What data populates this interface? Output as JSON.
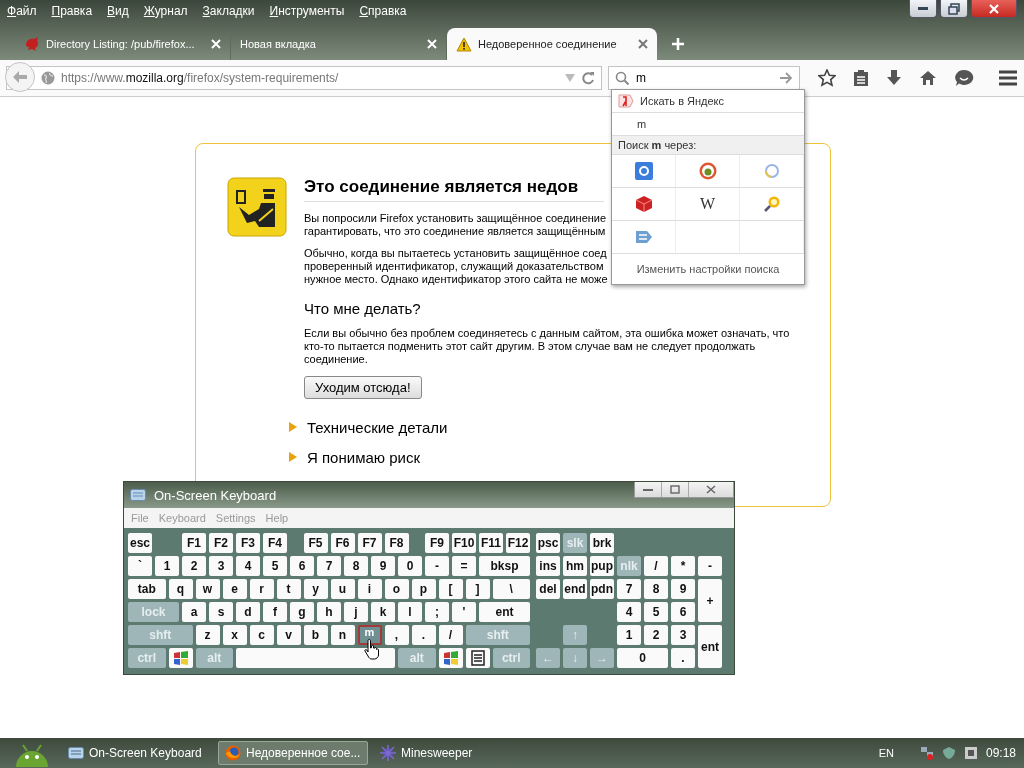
{
  "menu": [
    "Файл",
    "Правка",
    "Вид",
    "Журнал",
    "Закладки",
    "Инструменты",
    "Справка"
  ],
  "tabs": [
    {
      "title": "Directory Listing: /pub/firefox...",
      "kind": "site",
      "selected": false
    },
    {
      "title": "Новая вкладка",
      "kind": "plain",
      "selected": false
    },
    {
      "title": "Недоверенное соединение",
      "kind": "warning",
      "selected": true
    }
  ],
  "navbar": {
    "url": {
      "scheme": "https://www.",
      "domain": "mozilla.org",
      "path": "/firefox/system-requirements/"
    },
    "search": {
      "value": "m"
    }
  },
  "search_popup": {
    "header": "Искать в Яндекс",
    "query": "m",
    "via": "Поиск **m** через:",
    "engines": [
      {
        "kind": "google"
      },
      {
        "kind": "duck"
      },
      {
        "kind": "ring"
      },
      {
        "kind": "cube"
      },
      {
        "kind": "wiki",
        "label": "W"
      },
      {
        "kind": "magnifier"
      },
      {
        "kind": "arrow"
      }
    ],
    "settings": "Изменить настройки поиска"
  },
  "error": {
    "title": "Это соединение является недов",
    "paragraphs": [
      [
        "Вы попросили Firefox установить защищённое соединение",
        "гарантировать, что это соединение является защищённым"
      ],
      [
        "Обычно, когда вы пытаетесь установить защищённое соед",
        "проверенный идентификатор, служащий доказательством",
        "нужное место. Однако идентификатор этого сайта не може"
      ]
    ],
    "subtitle": "Что мне делать?",
    "advice": "Если вы обычно без проблем соединяетесь с данным сайтом, эта ошибка может означать, что кто-то пытается подменить этот сайт другим. В этом случае вам не следует продолжать соединение.",
    "button": "Уходим отсюда!",
    "sections": [
      {
        "label": "Технические детали",
        "expanded": false
      },
      {
        "label": "Я понимаю риск",
        "expanded": false
      }
    ]
  },
  "keyboard": {
    "title": "On-Screen Keyboard",
    "menu": [
      "File",
      "Keyboard",
      "Settings",
      "Help"
    ],
    "function_groups": [
      [
        {
          "label": "esc",
          "kind": "key",
          "disabled": false,
          "pressed": false
        }
      ],
      [
        {
          "label": "F1",
          "kind": "key",
          "disabled": false,
          "pressed": false
        },
        {
          "label": "F2",
          "kind": "key",
          "disabled": false,
          "pressed": false
        },
        {
          "label": "F3",
          "kind": "key",
          "disabled": false,
          "pressed": false
        },
        {
          "label": "F4",
          "kind": "key",
          "disabled": false,
          "pressed": false
        }
      ],
      [
        {
          "label": "F5",
          "kind": "key",
          "disabled": false,
          "pressed": false
        },
        {
          "label": "F6",
          "kind": "key",
          "disabled": false,
          "pressed": false
        },
        {
          "label": "F7",
          "kind": "key",
          "disabled": false,
          "pressed": false
        },
        {
          "label": "F8",
          "kind": "key",
          "disabled": false,
          "pressed": false
        }
      ],
      [
        {
          "label": "F9",
          "kind": "key",
          "disabled": false,
          "pressed": false
        },
        {
          "label": "F10",
          "kind": "key",
          "disabled": false,
          "pressed": false
        },
        {
          "label": "F11",
          "kind": "key",
          "disabled": false,
          "pressed": false
        },
        {
          "label": "F12",
          "kind": "key",
          "disabled": false,
          "pressed": false
        }
      ]
    ],
    "main_rows": [
      [
        {
          "label": "`",
          "kind": "key",
          "disabled": false,
          "pressed": false
        },
        {
          "label": "1",
          "kind": "key",
          "disabled": false,
          "pressed": false
        },
        {
          "label": "2",
          "kind": "key",
          "disabled": false,
          "pressed": false
        },
        {
          "label": "3",
          "kind": "key",
          "disabled": false,
          "pressed": false
        },
        {
          "label": "4",
          "kind": "key",
          "disabled": false,
          "pressed": false
        },
        {
          "label": "5",
          "kind": "key",
          "disabled": false,
          "pressed": false
        },
        {
          "label": "6",
          "kind": "key",
          "disabled": false,
          "pressed": false
        },
        {
          "label": "7",
          "kind": "key",
          "disabled": false,
          "pressed": false
        },
        {
          "label": "8",
          "kind": "key",
          "disabled": false,
          "pressed": false
        },
        {
          "label": "9",
          "kind": "key",
          "disabled": false,
          "pressed": false
        },
        {
          "label": "0",
          "kind": "key",
          "disabled": false,
          "pressed": false
        },
        {
          "label": "-",
          "kind": "key",
          "disabled": false,
          "pressed": false
        },
        {
          "label": "=",
          "kind": "key",
          "disabled": false,
          "pressed": false
        },
        {
          "label": "bksp",
          "kind": "wide",
          "disabled": false,
          "pressed": false
        }
      ],
      [
        {
          "label": "tab",
          "kind": "medium",
          "disabled": false,
          "pressed": false
        },
        {
          "label": "q",
          "kind": "key",
          "disabled": false,
          "pressed": false
        },
        {
          "label": "w",
          "kind": "key",
          "disabled": false,
          "pressed": false
        },
        {
          "label": "e",
          "kind": "key",
          "disabled": false,
          "pressed": false
        },
        {
          "label": "r",
          "kind": "key",
          "disabled": false,
          "pressed": false
        },
        {
          "label": "t",
          "kind": "key",
          "disabled": false,
          "pressed": false
        },
        {
          "label": "y",
          "kind": "key",
          "disabled": false,
          "pressed": false
        },
        {
          "label": "u",
          "kind": "key",
          "disabled": false,
          "pressed": false
        },
        {
          "label": "i",
          "kind": "key",
          "disabled": false,
          "pressed": false
        },
        {
          "label": "o",
          "kind": "key",
          "disabled": false,
          "pressed": false
        },
        {
          "label": "p",
          "kind": "key",
          "disabled": false,
          "pressed": false
        },
        {
          "label": "[",
          "kind": "key",
          "disabled": false,
          "pressed": false
        },
        {
          "label": "]",
          "kind": "key",
          "disabled": false,
          "pressed": false
        },
        {
          "label": "\\",
          "kind": "medium",
          "disabled": false,
          "pressed": false
        }
      ],
      [
        {
          "label": "lock",
          "kind": "wide",
          "disabled": true,
          "pressed": false
        },
        {
          "label": "a",
          "kind": "key",
          "disabled": false,
          "pressed": false
        },
        {
          "label": "s",
          "kind": "key",
          "disabled": false,
          "pressed": false
        },
        {
          "label": "d",
          "kind": "key",
          "disabled": false,
          "pressed": false
        },
        {
          "label": "f",
          "kind": "key",
          "disabled": false,
          "pressed": false
        },
        {
          "label": "g",
          "kind": "key",
          "disabled": false,
          "pressed": false
        },
        {
          "label": "h",
          "kind": "key",
          "disabled": false,
          "pressed": false
        },
        {
          "label": "j",
          "kind": "key",
          "disabled": false,
          "pressed": false
        },
        {
          "label": "k",
          "kind": "key",
          "disabled": false,
          "pressed": false
        },
        {
          "label": "l",
          "kind": "key",
          "disabled": false,
          "pressed": false
        },
        {
          "label": ";",
          "kind": "key",
          "disabled": false,
          "pressed": false
        },
        {
          "label": "'",
          "kind": "key",
          "disabled": false,
          "pressed": false
        },
        {
          "label": "ent",
          "kind": "wide",
          "disabled": false,
          "pressed": false
        }
      ],
      [
        {
          "label": "shft",
          "kind": "wider",
          "disabled": true,
          "pressed": false
        },
        {
          "label": "z",
          "kind": "key",
          "disabled": false,
          "pressed": false
        },
        {
          "label": "x",
          "kind": "key",
          "disabled": false,
          "pressed": false
        },
        {
          "label": "c",
          "kind": "key",
          "disabled": false,
          "pressed": false
        },
        {
          "label": "v",
          "kind": "key",
          "disabled": false,
          "pressed": false
        },
        {
          "label": "b",
          "kind": "key",
          "disabled": false,
          "pressed": false
        },
        {
          "label": "n",
          "kind": "key",
          "disabled": false,
          "pressed": false
        },
        {
          "label": "m",
          "kind": "key",
          "disabled": false,
          "pressed": true
        },
        {
          "label": ",",
          "kind": "key",
          "disabled": false,
          "pressed": false
        },
        {
          "label": ".",
          "kind": "key",
          "disabled": false,
          "pressed": false
        },
        {
          "label": "/",
          "kind": "key",
          "disabled": false,
          "pressed": false
        },
        {
          "label": "shft",
          "kind": "wider",
          "disabled": true,
          "pressed": false
        }
      ],
      [
        {
          "label": "ctrl",
          "kind": "medium",
          "disabled": true,
          "pressed": false
        },
        {
          "kind": "windows",
          "disabled": false,
          "pressed": false
        },
        {
          "label": "alt",
          "kind": "medium",
          "disabled": true,
          "pressed": false
        },
        {
          "kind": "space",
          "disabled": false,
          "pressed": false
        },
        {
          "label": "alt",
          "kind": "medium",
          "disabled": true,
          "pressed": false
        },
        {
          "kind": "windows",
          "disabled": false,
          "pressed": false
        },
        {
          "kind": "menu",
          "disabled": false,
          "pressed": false
        },
        {
          "label": "ctrl",
          "kind": "medium",
          "disabled": true,
          "pressed": false
        }
      ]
    ],
    "nav_rows": [
      [
        {
          "label": "psc",
          "kind": "key",
          "disabled": false,
          "pressed": false
        },
        {
          "label": "slk",
          "kind": "key",
          "disabled": true,
          "pressed": false
        },
        {
          "label": "brk",
          "kind": "key",
          "disabled": false,
          "pressed": false
        }
      ],
      [
        {
          "label": "ins",
          "kind": "key",
          "disabled": false,
          "pressed": false
        },
        {
          "label": "hm",
          "kind": "key",
          "disabled": false,
          "pressed": false
        },
        {
          "label": "pup",
          "kind": "key",
          "disabled": false,
          "pressed": false
        }
      ],
      [
        {
          "label": "del",
          "kind": "key",
          "disabled": false,
          "pressed": false
        },
        {
          "label": "end",
          "kind": "key",
          "disabled": false,
          "pressed": false
        },
        {
          "label": "pdn",
          "kind": "key",
          "disabled": false,
          "pressed": false
        }
      ]
    ],
    "arrow_rows": [
      [
        {
          "label": "↑",
          "kind": "key",
          "disabled": true,
          "pressed": false
        }
      ],
      [
        {
          "label": "←",
          "kind": "key",
          "disabled": true,
          "pressed": false
        },
        {
          "label": "↓",
          "kind": "key",
          "disabled": true,
          "pressed": false
        },
        {
          "label": "→",
          "kind": "key",
          "disabled": true,
          "pressed": false
        }
      ]
    ],
    "numpad": [
      {
        "label": "nlk",
        "kind": "key",
        "disabled": true,
        "pressed": false
      },
      {
        "label": "/",
        "kind": "key",
        "disabled": false,
        "pressed": false
      },
      {
        "label": "*",
        "kind": "key",
        "disabled": false,
        "pressed": false
      },
      {
        "label": "-",
        "kind": "key",
        "disabled": false,
        "pressed": false
      },
      {
        "label": "7",
        "kind": "key",
        "disabled": false,
        "pressed": false
      },
      {
        "label": "8",
        "kind": "key",
        "disabled": false,
        "pressed": false
      },
      {
        "label": "9",
        "kind": "key",
        "disabled": false,
        "pressed": false
      },
      {
        "label": "+",
        "kind": "tall",
        "disabled": false,
        "pressed": false
      },
      {
        "label": "4",
        "kind": "key",
        "disabled": false,
        "pressed": false
      },
      {
        "label": "5",
        "kind": "key",
        "disabled": false,
        "pressed": false
      },
      {
        "label": "6",
        "kind": "key",
        "disabled": false,
        "pressed": false
      },
      {
        "label": "1",
        "kind": "key",
        "disabled": false,
        "pressed": false
      },
      {
        "label": "2",
        "kind": "key",
        "disabled": false,
        "pressed": false
      },
      {
        "label": "3",
        "kind": "key",
        "disabled": false,
        "pressed": false
      },
      {
        "label": "ent",
        "kind": "tall",
        "disabled": false,
        "pressed": false
      },
      {
        "label": "0",
        "kind": "double",
        "disabled": false,
        "pressed": false
      },
      {
        "label": ".",
        "kind": "key",
        "disabled": false,
        "pressed": false
      }
    ]
  },
  "taskbar": {
    "tasks": [
      {
        "label": "On-Screen Keyboard",
        "kind": "keyboard",
        "selected": false
      },
      {
        "label": "Недоверенное сое...",
        "kind": "browser",
        "selected": true
      },
      {
        "label": "Minesweeper",
        "kind": "mine",
        "selected": false
      }
    ],
    "language": "EN",
    "clock": "09:18"
  }
}
